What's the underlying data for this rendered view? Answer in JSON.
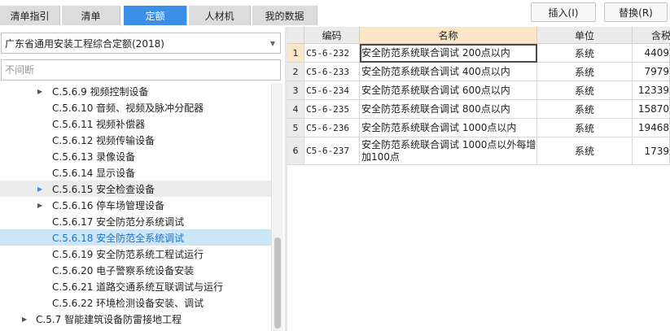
{
  "tabs": [
    {
      "label": "清单指引",
      "active": false
    },
    {
      "label": "清单",
      "active": false
    },
    {
      "label": "定额",
      "active": true
    },
    {
      "label": "人材机",
      "active": false
    },
    {
      "label": "我的数据",
      "active": false
    }
  ],
  "toolbar": {
    "insert_label": "插入(I)",
    "replace_label": "替换(R)"
  },
  "library": {
    "selected": "广东省通用安装工程综合定额(2018)"
  },
  "filter": {
    "value": "",
    "placeholder": "不间断"
  },
  "tree": [
    {
      "label": "C.5.6.9 视频控制设备",
      "expandable": true,
      "state": "normal"
    },
    {
      "label": "C.5.6.10 音频、视频及脉冲分配器",
      "expandable": false,
      "state": "normal"
    },
    {
      "label": "C.5.6.11 视频补偿器",
      "expandable": false,
      "state": "normal"
    },
    {
      "label": "C.5.6.12 视频传输设备",
      "expandable": false,
      "state": "normal"
    },
    {
      "label": "C.5.6.13 录像设备",
      "expandable": false,
      "state": "normal"
    },
    {
      "label": "C.5.6.14 显示设备",
      "expandable": false,
      "state": "normal"
    },
    {
      "label": "C.5.6.15 安全检查设备",
      "expandable": true,
      "state": "hover"
    },
    {
      "label": "C.5.6.16 停车场管理设备",
      "expandable": true,
      "state": "normal"
    },
    {
      "label": "C.5.6.17 安全防范分系统调试",
      "expandable": false,
      "state": "normal"
    },
    {
      "label": "C.5.6.18 安全防范全系统调试",
      "expandable": false,
      "state": "selected"
    },
    {
      "label": "C.5.6.19 安全防范系统工程试运行",
      "expandable": false,
      "state": "normal"
    },
    {
      "label": "C.5.6.20 电子警察系统设备安装",
      "expandable": false,
      "state": "normal"
    },
    {
      "label": "C.5.6.21 道路交通系统互联调试与运行",
      "expandable": false,
      "state": "normal"
    },
    {
      "label": "C.5.6.22 环境检测设备安装、调试",
      "expandable": false,
      "state": "normal"
    },
    {
      "label": "C.5.7 智能建筑设备防雷接地工程",
      "expandable": true,
      "state": "normal",
      "level": 1
    }
  ],
  "grid": {
    "columns": [
      "编码",
      "名称",
      "单位",
      "含税单"
    ],
    "sorted_column": "名称",
    "rows": [
      {
        "n": "1",
        "code": "C5-6-232",
        "name": "安全防范系统联合调试 200点以内",
        "unit": "系统",
        "price": "4409",
        "current": true
      },
      {
        "n": "2",
        "code": "C5-6-233",
        "name": "安全防范系统联合调试 400点以内",
        "unit": "系统",
        "price": "7979",
        "current": false
      },
      {
        "n": "3",
        "code": "C5-6-234",
        "name": "安全防范系统联合调试 600点以内",
        "unit": "系统",
        "price": "12339",
        "current": false
      },
      {
        "n": "4",
        "code": "C5-6-235",
        "name": "安全防范系统联合调试 800点以内",
        "unit": "系统",
        "price": "15870",
        "current": false
      },
      {
        "n": "5",
        "code": "C5-6-236",
        "name": "安全防范系统联合调试 1000点以内",
        "unit": "系统",
        "price": "19468",
        "current": false
      },
      {
        "n": "6",
        "code": "C5-6-237",
        "name": "安全防范系统联合调试 1000点以外每增加100点",
        "unit": "系统",
        "price": "1739",
        "current": false
      }
    ]
  },
  "colors": {
    "accent": "#3c8fe6",
    "selected_bg": "#cde6f7",
    "header_sorted": "#fbe7c8"
  }
}
